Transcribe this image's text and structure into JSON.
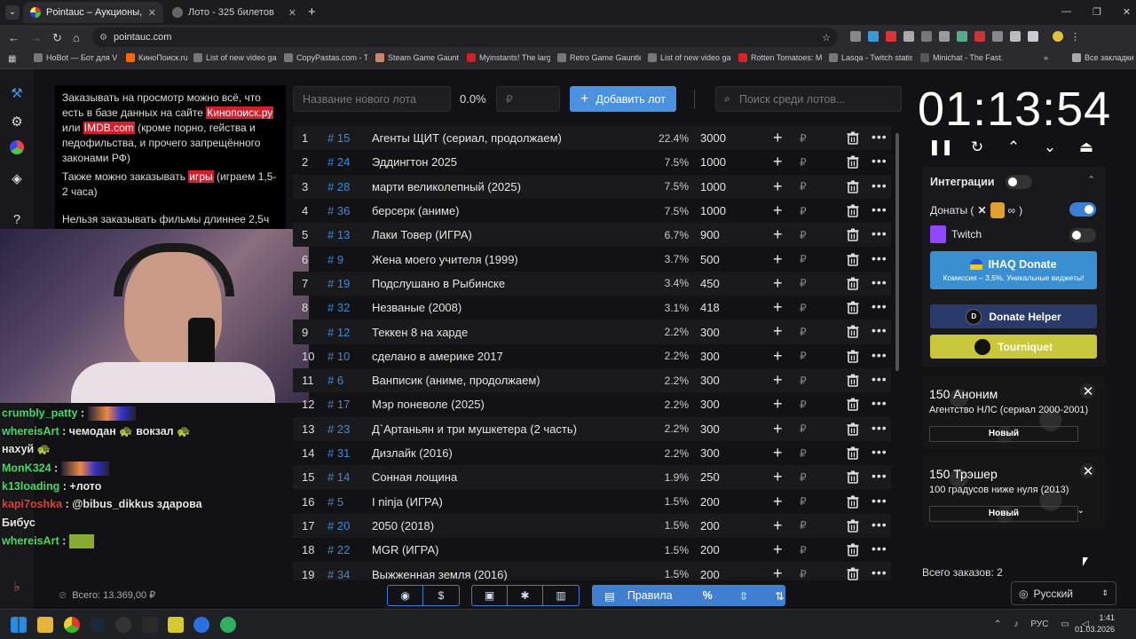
{
  "browser": {
    "tabs": [
      {
        "title": "Pointauc – Аукционы, лотереи"
      },
      {
        "title": "Лото - 325 билетов"
      }
    ],
    "new_tab": "+",
    "url": "pointauc.com",
    "bookmarks": [
      "HoBot — Бот для V...",
      "КиноПоиск.ru",
      "List of new video ga...",
      "CopyPastas.com - T...",
      "Steam Game Gauntlet",
      "Myinstants! The larg...",
      "Retro Game Gauntlet",
      "List of new video ga...",
      "Rotten Tomatoes: M...",
      "Lasqa - Twitch statis...",
      "Minichat - The Fast..."
    ],
    "all_bookmarks": "Все закладки"
  },
  "notice": {
    "p1_a": "Заказывать на просмотр можно всё, что есть в базе данных на сайте ",
    "p1_link1": "Кинопоиск.ру",
    "p1_b": " или ",
    "p1_link2": "IMDB.com",
    "p1_c": " (кроме порно, гейства и педофильства, и прочего запрещённого законами РФ)",
    "p2_a": "Также можно заказывать ",
    "p2_link": "игры",
    "p2_b": " (играем 1,5-2 часа)",
    "p3": "Нельзя заказывать фильмы длиннее 2,5ч"
  },
  "chat": [
    {
      "nick": "crumbly_patty",
      "sep": " :",
      "msg": ""
    },
    {
      "nick": "whereisArt",
      "sep": " :",
      "msg": " чемодан 🐢 вокзал 🐢"
    },
    {
      "nick": "",
      "sep": "",
      "msg": "нахуй 🐢"
    },
    {
      "nick": "MonK324",
      "sep": " :",
      "msg": ""
    },
    {
      "nick": "k13loading",
      "sep": " :",
      "msg": " +лото"
    },
    {
      "nick": "kapi7oshka",
      "sep": " :",
      "msg": " @bibus_dikkus здарова"
    },
    {
      "nick": "",
      "sep": "",
      "msg": "Бибус"
    },
    {
      "nick": "whereisArt",
      "sep": " :",
      "msg": ""
    }
  ],
  "total_label": "Всего: 13.369,00 ₽",
  "lot_bar": {
    "name_placeholder": "Название нового лота",
    "percent": "0.0%",
    "amount_placeholder": "₽",
    "add_button": "Добавить лот",
    "search_placeholder": "Поиск среди лотов..."
  },
  "lots": [
    {
      "n": "1",
      "id": "# 15",
      "name": "Агенты ЩИТ (сериал, продолжаем)",
      "pct": "22.4%",
      "amount": "3000"
    },
    {
      "n": "2",
      "id": "# 24",
      "name": "Эддингтон 2025",
      "pct": "7.5%",
      "amount": "1000"
    },
    {
      "n": "3",
      "id": "# 28",
      "name": "марти великолепный (2025)",
      "pct": "7.5%",
      "amount": "1000"
    },
    {
      "n": "4",
      "id": "# 36",
      "name": "берсерк (аниме)",
      "pct": "7.5%",
      "amount": "1000"
    },
    {
      "n": "5",
      "id": "# 13",
      "name": "Лаки Товер (ИГРА)",
      "pct": "6.7%",
      "amount": "900"
    },
    {
      "n": "6",
      "id": "# 9",
      "name": "Жена моего учителя (1999)",
      "pct": "3.7%",
      "amount": "500"
    },
    {
      "n": "7",
      "id": "# 19",
      "name": "Подслушано в Рыбинске",
      "pct": "3.4%",
      "amount": "450"
    },
    {
      "n": "8",
      "id": "# 32",
      "name": "Незваные (2008)",
      "pct": "3.1%",
      "amount": "418"
    },
    {
      "n": "9",
      "id": "# 12",
      "name": "Теккен 8 на харде",
      "pct": "2.2%",
      "amount": "300"
    },
    {
      "n": "10",
      "id": "# 10",
      "name": "сделано в америке 2017",
      "pct": "2.2%",
      "amount": "300"
    },
    {
      "n": "11",
      "id": "# 6",
      "name": "Ванписик (аниме, продолжаем)",
      "pct": "2.2%",
      "amount": "300"
    },
    {
      "n": "12",
      "id": "# 17",
      "name": "Мэр поневоле (2025)",
      "pct": "2.2%",
      "amount": "300"
    },
    {
      "n": "13",
      "id": "# 23",
      "name": "Д`Артаньян и три мушкетера (2 часть)",
      "pct": "2.2%",
      "amount": "300"
    },
    {
      "n": "14",
      "id": "# 31",
      "name": "Дизлайк (2016)",
      "pct": "2.2%",
      "amount": "300"
    },
    {
      "n": "15",
      "id": "# 14",
      "name": "Сонная лощина",
      "pct": "1.9%",
      "amount": "250"
    },
    {
      "n": "16",
      "id": "# 5",
      "name": "I ninja (ИГРА)",
      "pct": "1.5%",
      "amount": "200"
    },
    {
      "n": "17",
      "id": "# 20",
      "name": "2050 (2018)",
      "pct": "1.5%",
      "amount": "200"
    },
    {
      "n": "18",
      "id": "# 22",
      "name": "MGR (ИГРА)",
      "pct": "1.5%",
      "amount": "200"
    },
    {
      "n": "19",
      "id": "# 34",
      "name": "Выжженная земля (2016)",
      "pct": "1.5%",
      "amount": "200"
    }
  ],
  "row_plus": "+",
  "row_rub": "₽",
  "row_more": "•••",
  "toolbar": {
    "rules_label": "Правила",
    "percent": "%"
  },
  "timer": "01:13:54",
  "integrations": {
    "title": "Интеграции",
    "donations": "Донаты (",
    "donations_end": ")",
    "twitch": "Twitch",
    "ihaq_title": "IHAQ Donate",
    "ihaq_sub": "Комиссия – 3,5%. Уникальные виджеты!",
    "donate_helper": "Donate Helper",
    "tourniquet": "Tourniquet"
  },
  "orders": [
    {
      "amount": "150 Аноним",
      "desc": "Агентство НЛС (сериал 2000-2001)",
      "status": "Новый"
    },
    {
      "amount": "150 Трэшер",
      "desc": "100 градусов ниже нуля (2013)",
      "status": "Новый"
    }
  ],
  "orders_total": "Всего заказов:  2",
  "language": "Русский",
  "system": {
    "lang": "РУС",
    "time": "1:41",
    "date": "01.03.2026"
  },
  "colors": {
    "accent": "#4a92e0",
    "link_red": "#d21f2b",
    "chat_nick": "#3ee06b",
    "tourniquet": "#c8c83a",
    "ihaq": "#3a8fd0"
  }
}
